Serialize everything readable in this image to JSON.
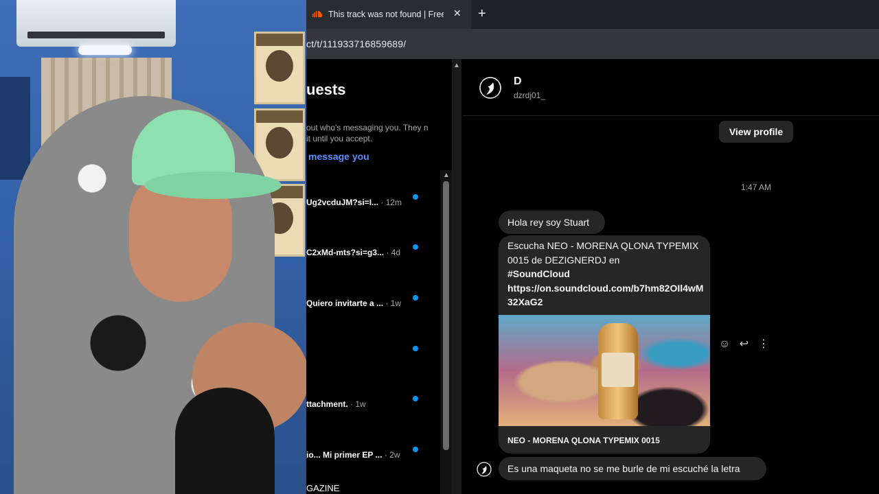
{
  "browser": {
    "tab_title": "This track was not found | Free",
    "tab_close": "✕",
    "new_tab": "+",
    "url": "ct/t/111933716859689/"
  },
  "requests": {
    "title": "uests",
    "description": "out who's messaging you. They n it until you accept.",
    "link": "message you",
    "threads": [
      {
        "snippet": "Ug2vcduJM?si=I...",
        "time": "· 12m"
      },
      {
        "snippet": "C2xMd-mts?si=g3...",
        "time": "· 4d"
      },
      {
        "snippet": "Quiero invitarte a ...",
        "time": "· 1w"
      },
      {
        "snippet": "",
        "time": ""
      },
      {
        "snippet": "ttachment.",
        "time": "· 1w"
      },
      {
        "snippet": "io... Mi primer EP ...",
        "time": "· 2w"
      }
    ],
    "bottom_label": "GAZINE"
  },
  "conversation": {
    "contact_name": "D",
    "contact_handle": "dzrdj01_",
    "view_profile": "View profile",
    "timestamp": "1:47 AM",
    "msg1": "Hola rey soy Stuart",
    "link_text": "Escucha NEO - MORENA QLONA TYPEMIX 0015 de DEZIGNERDJ en",
    "hashtag": "#SoundCloud",
    "link_url": "https://on.soundcloud.com/b7hm82OIl4wM32XaG2",
    "card_title": "NEO - MORENA QLONA TYPEMIX 0015",
    "msg3": "Es una maqueta no se me burle de mi escuché la letra"
  },
  "icons": {
    "soundcloud": "soundcloud-icon",
    "react": "☺",
    "reply": "↩",
    "more": "⋮"
  },
  "colors": {
    "accent_blue": "#0095f6",
    "link_blue": "#5b8cff",
    "bubble": "#262626"
  }
}
